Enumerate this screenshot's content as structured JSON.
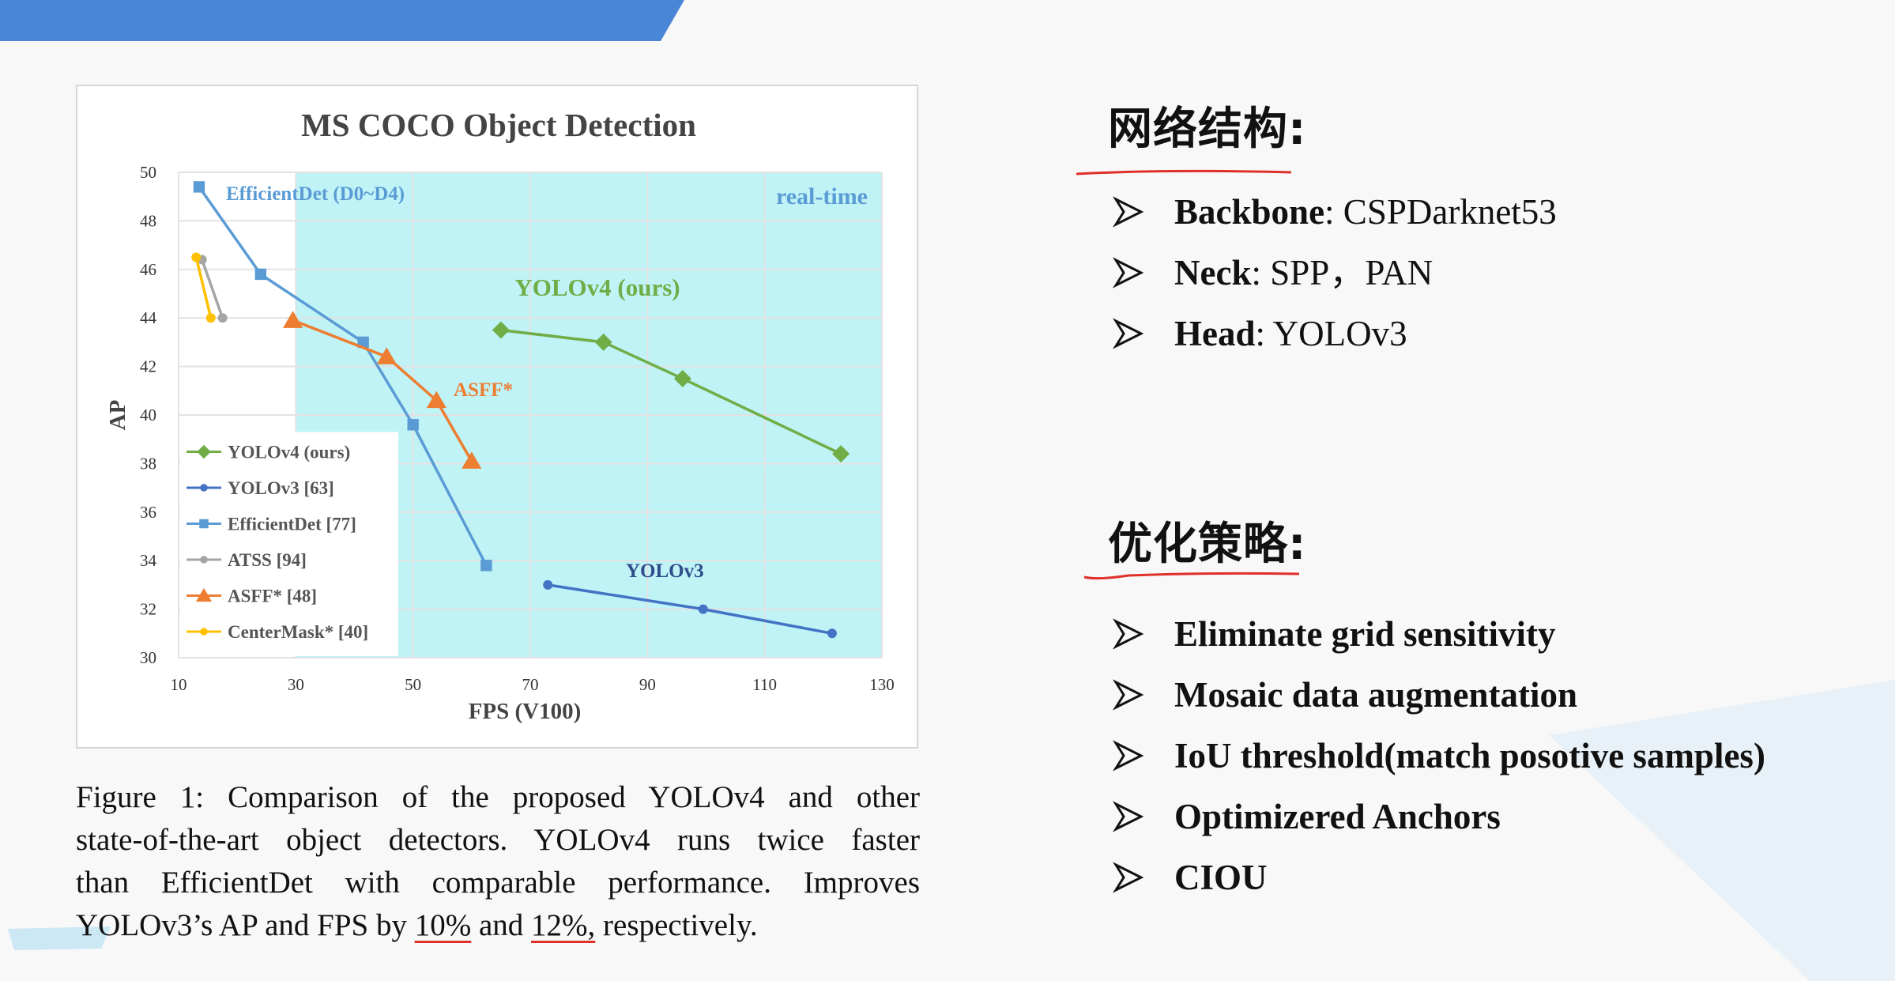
{
  "chart_data": {
    "type": "line",
    "title": "MS COCO Object Detection",
    "xlabel": "FPS (V100)",
    "ylabel": "AP",
    "xlim": [
      10,
      130
    ],
    "ylim": [
      30,
      50
    ],
    "xticks": [
      "10",
      "30",
      "50",
      "70",
      "90",
      "110",
      "130"
    ],
    "yticks": [
      "30",
      "32",
      "34",
      "36",
      "38",
      "40",
      "42",
      "44",
      "46",
      "48",
      "50"
    ],
    "grid": true,
    "shaded_region": {
      "label": "real-time",
      "x_from": 30,
      "x_to": 130,
      "color": "#bff3f6"
    },
    "legend_position": "bottom-left",
    "series": [
      {
        "name": "YOLOv4 (ours)",
        "marker": "diamond",
        "color": "#70ad47",
        "x": [
          65,
          82.5,
          96,
          123
        ],
        "y": [
          43.5,
          43.0,
          41.5,
          38.4
        ]
      },
      {
        "name": "YOLOv3 [63]",
        "marker": "circle",
        "color": "#4472c4",
        "x": [
          73,
          99.5,
          121.5
        ],
        "y": [
          33.0,
          32.0,
          31.0
        ]
      },
      {
        "name": "EfficientDet [77]",
        "marker": "square",
        "color": "#5b9bd5",
        "x": [
          13.5,
          24,
          41.5,
          50,
          62.5
        ],
        "y": [
          49.4,
          45.8,
          43.0,
          39.6,
          33.8
        ]
      },
      {
        "name": "ATSS [94]",
        "marker": "circle",
        "color": "#a5a5a5",
        "x": [
          14,
          17.5
        ],
        "y": [
          46.4,
          44.0
        ]
      },
      {
        "name": "ASFF* [48]",
        "marker": "triangle",
        "color": "#ed7d31",
        "x": [
          29.5,
          45.5,
          54,
          60
        ],
        "y": [
          43.9,
          42.4,
          40.6,
          38.1
        ]
      },
      {
        "name": "CenterMask* [40]",
        "marker": "circle",
        "color": "#ffc000",
        "x": [
          13,
          15.5
        ],
        "y": [
          46.5,
          44.0
        ]
      }
    ],
    "annotations": [
      {
        "text": "EfficientDet (D0~D4)",
        "color": "#5b9bd5"
      },
      {
        "text": "real-time",
        "color": "#5b9bd5"
      },
      {
        "text": "YOLOv4 (ours)",
        "color": "#70ad47"
      },
      {
        "text": "ASFF*",
        "color": "#ed7d31"
      },
      {
        "text": "YOLOv3",
        "color": "#2e4d8a"
      }
    ]
  },
  "caption": {
    "lines": [
      "Figure 1: Comparison of the proposed YOLOv4 and other",
      "state-of-the-art object detectors. YOLOv4 runs twice faster",
      "than EfficientDet with comparable performance. Improves"
    ],
    "last_prefix": "YOLOv3’s AP and FPS by ",
    "pct1": "10%",
    "mid": " and ",
    "pct2": "12%,",
    "suffix": " respectively."
  },
  "section1": {
    "title": "网络结构:",
    "items": [
      {
        "key": "Backbone",
        "value": ": CSPDarknet53"
      },
      {
        "key": "Neck",
        "value": ": SPP，PAN"
      },
      {
        "key": "Head",
        "value": ": YOLOv3"
      }
    ]
  },
  "section2": {
    "title": "优化策略:",
    "items": [
      "Eliminate grid sensitivity",
      "Mosaic data augmentation",
      "IoU threshold(match posotive samples)",
      "Optimizered Anchors",
      "CIOU"
    ]
  },
  "colors": {
    "accent_blue": "#4a86d8",
    "underline_red": "#e0302a"
  }
}
